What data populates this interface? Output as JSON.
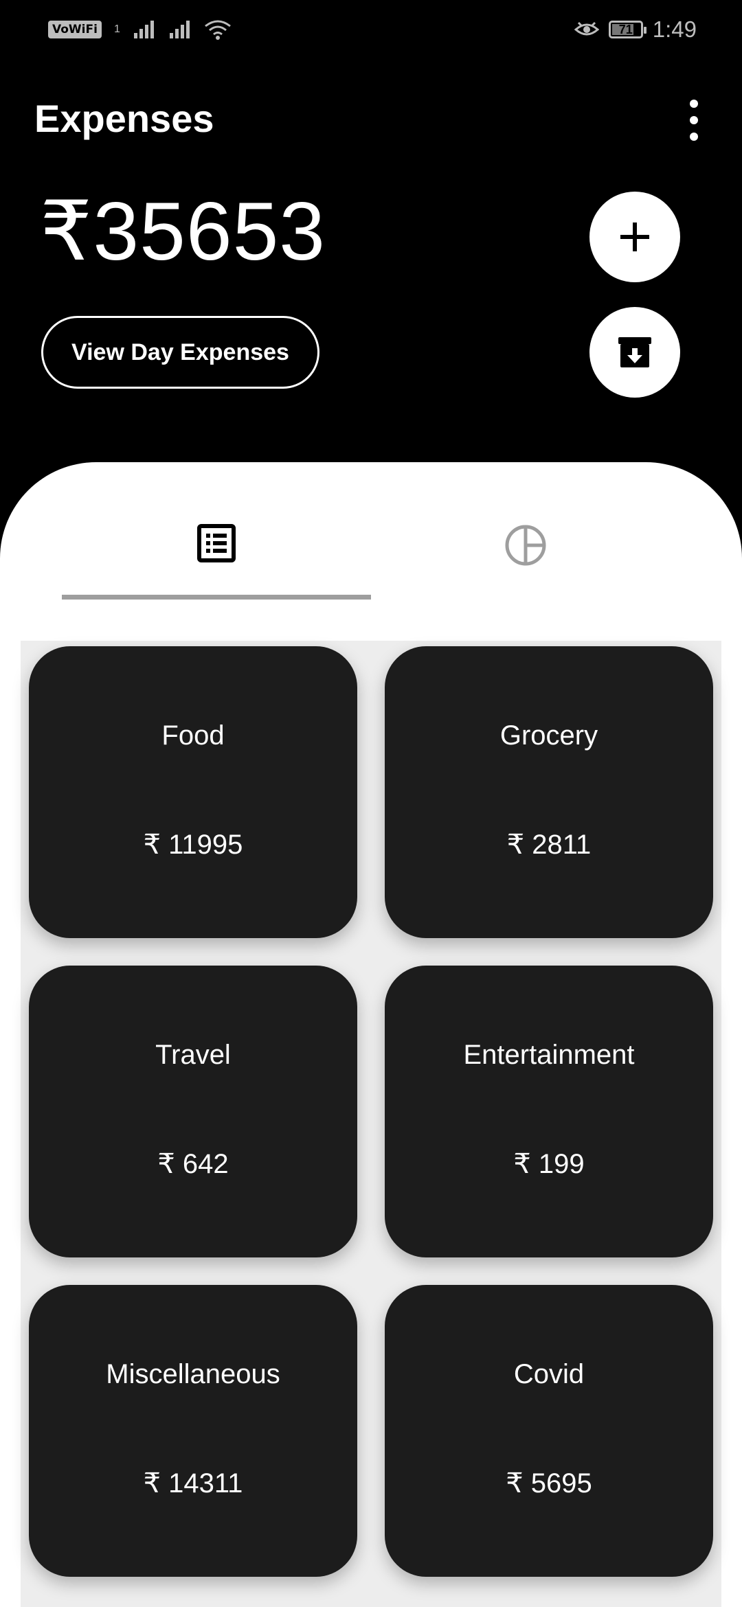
{
  "status_bar": {
    "vowifi": "VoWiFi",
    "sim": "1",
    "battery": "71",
    "battery_level": 0.71,
    "time": "1:49"
  },
  "header": {
    "title": "Expenses",
    "total": "₹35653",
    "view_day_label": "View Day Expenses"
  },
  "tabs": [
    {
      "icon": "list-icon",
      "active": true
    },
    {
      "icon": "pie-chart-icon",
      "active": false
    }
  ],
  "categories": [
    {
      "name": "Food",
      "amount": "₹ 11995"
    },
    {
      "name": "Grocery",
      "amount": "₹ 2811"
    },
    {
      "name": "Travel",
      "amount": "₹ 642"
    },
    {
      "name": "Entertainment",
      "amount": "₹ 199"
    },
    {
      "name": "Miscellaneous",
      "amount": "₹ 14311"
    },
    {
      "name": "Covid",
      "amount": "₹ 5695"
    }
  ],
  "colors": {
    "background": "#000000",
    "panel": "#ffffff",
    "card": "#1c1c1c",
    "tab_indicator": "#9e9e9e"
  }
}
